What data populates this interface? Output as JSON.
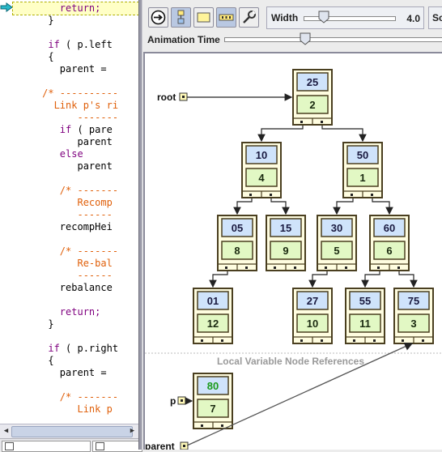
{
  "code": {
    "lines": [
      {
        "indent": "        ",
        "tokens": [
          {
            "t": "return;",
            "k": "kw"
          }
        ],
        "highlight": true
      },
      {
        "indent": "      ",
        "tokens": [
          {
            "t": "}",
            "k": "tx"
          }
        ]
      },
      {
        "indent": "",
        "tokens": []
      },
      {
        "indent": "      ",
        "tokens": [
          {
            "t": "if",
            "k": "kw"
          },
          {
            "t": " ( p.left",
            "k": "tx"
          }
        ]
      },
      {
        "indent": "      ",
        "tokens": [
          {
            "t": "{",
            "k": "tx"
          }
        ]
      },
      {
        "indent": "        ",
        "tokens": [
          {
            "t": "parent =",
            "k": "tx"
          }
        ]
      },
      {
        "indent": "",
        "tokens": []
      },
      {
        "indent": "     ",
        "tokens": [
          {
            "t": "/* ----------",
            "k": "cm"
          }
        ]
      },
      {
        "indent": "       ",
        "tokens": [
          {
            "t": "Link p's ri",
            "k": "cm"
          }
        ]
      },
      {
        "indent": "           ",
        "tokens": [
          {
            "t": "-------",
            "k": "cm"
          }
        ]
      },
      {
        "indent": "        ",
        "tokens": [
          {
            "t": "if",
            "k": "kw"
          },
          {
            "t": " ( pare",
            "k": "tx"
          }
        ]
      },
      {
        "indent": "           ",
        "tokens": [
          {
            "t": "parent",
            "k": "tx"
          }
        ]
      },
      {
        "indent": "        ",
        "tokens": [
          {
            "t": "else",
            "k": "kw"
          }
        ]
      },
      {
        "indent": "           ",
        "tokens": [
          {
            "t": "parent",
            "k": "tx"
          }
        ]
      },
      {
        "indent": "",
        "tokens": []
      },
      {
        "indent": "        ",
        "tokens": [
          {
            "t": "/* -------",
            "k": "cm"
          }
        ]
      },
      {
        "indent": "           ",
        "tokens": [
          {
            "t": "Recomp",
            "k": "cm"
          }
        ]
      },
      {
        "indent": "           ",
        "tokens": [
          {
            "t": "------",
            "k": "cm"
          }
        ]
      },
      {
        "indent": "        ",
        "tokens": [
          {
            "t": "recompHei",
            "k": "tx"
          }
        ]
      },
      {
        "indent": "",
        "tokens": []
      },
      {
        "indent": "        ",
        "tokens": [
          {
            "t": "/* -------",
            "k": "cm"
          }
        ]
      },
      {
        "indent": "           ",
        "tokens": [
          {
            "t": "Re-bal",
            "k": "cm"
          }
        ]
      },
      {
        "indent": "           ",
        "tokens": [
          {
            "t": "------",
            "k": "cm"
          }
        ]
      },
      {
        "indent": "        ",
        "tokens": [
          {
            "t": "rebalance",
            "k": "tx"
          }
        ]
      },
      {
        "indent": "",
        "tokens": []
      },
      {
        "indent": "        ",
        "tokens": [
          {
            "t": "return;",
            "k": "kw"
          }
        ]
      },
      {
        "indent": "      ",
        "tokens": [
          {
            "t": "}",
            "k": "tx"
          }
        ]
      },
      {
        "indent": "",
        "tokens": []
      },
      {
        "indent": "      ",
        "tokens": [
          {
            "t": "if",
            "k": "kw"
          },
          {
            "t": " ( p.right",
            "k": "tx"
          }
        ]
      },
      {
        "indent": "      ",
        "tokens": [
          {
            "t": "{",
            "k": "tx"
          }
        ]
      },
      {
        "indent": "        ",
        "tokens": [
          {
            "t": "parent =",
            "k": "tx"
          }
        ]
      },
      {
        "indent": "",
        "tokens": []
      },
      {
        "indent": "        ",
        "tokens": [
          {
            "t": "/* -------",
            "k": "cm"
          }
        ]
      },
      {
        "indent": "           ",
        "tokens": [
          {
            "t": "Link p",
            "k": "cm"
          }
        ]
      }
    ]
  },
  "toolbar": {
    "buttons": [
      {
        "name": "step-button",
        "icon": "step-arrow-icon",
        "active": false
      },
      {
        "name": "layout-button",
        "icon": "tree-layout-icon",
        "active": true
      },
      {
        "name": "box-view-button",
        "icon": "box-icon",
        "active": false
      },
      {
        "name": "array-view-button",
        "icon": "array-icon",
        "active": true
      },
      {
        "name": "settings-button",
        "icon": "wrench-icon",
        "active": false
      }
    ],
    "width_label": "Width",
    "width_value": "4.0",
    "width_slider_fraction": 0.12,
    "sc_label": "Sc"
  },
  "animation": {
    "label": "Animation Time",
    "slider_fraction": 0.37
  },
  "tree": {
    "root_label": "root",
    "nodes": [
      {
        "id": "n25",
        "key": "25",
        "height": "2"
      },
      {
        "id": "n10",
        "key": "10",
        "height": "4"
      },
      {
        "id": "n50",
        "key": "50",
        "height": "1"
      },
      {
        "id": "n05",
        "key": "05",
        "height": "8"
      },
      {
        "id": "n15",
        "key": "15",
        "height": "9"
      },
      {
        "id": "n30",
        "key": "30",
        "height": "5"
      },
      {
        "id": "n60",
        "key": "60",
        "height": "6"
      },
      {
        "id": "n01",
        "key": "01",
        "height": "12"
      },
      {
        "id": "n27",
        "key": "27",
        "height": "10"
      },
      {
        "id": "n55",
        "key": "55",
        "height": "11"
      },
      {
        "id": "n75",
        "key": "75",
        "height": "3"
      }
    ],
    "edges": [
      [
        "n25",
        "n10"
      ],
      [
        "n25",
        "n50"
      ],
      [
        "n10",
        "n05"
      ],
      [
        "n10",
        "n15"
      ],
      [
        "n50",
        "n30"
      ],
      [
        "n50",
        "n60"
      ],
      [
        "n05",
        "n01"
      ],
      [
        "n30",
        "n27"
      ],
      [
        "n60",
        "n55"
      ],
      [
        "n60",
        "n75"
      ]
    ]
  },
  "locals": {
    "section_label": "Local Variable Node References",
    "p_label": "p",
    "parent_label": "parent",
    "p_node": {
      "key": "80",
      "height": "7",
      "key_color": "#1a9a1a"
    }
  },
  "colors": {
    "key_cell": "#cfe3fb",
    "height_cell": "#e2f8c4",
    "node_border": "#4a3f20",
    "node_frame": "#fffde0",
    "exec_arrow": "#28b8c8"
  }
}
